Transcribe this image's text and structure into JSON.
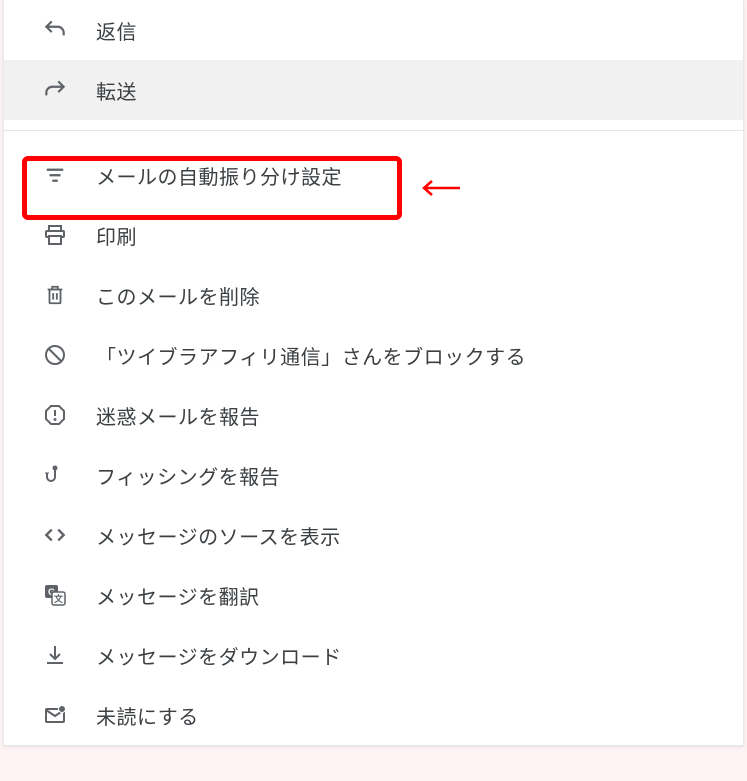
{
  "menu": {
    "items": [
      {
        "id": "reply",
        "label": "返信",
        "icon": "reply-icon"
      },
      {
        "id": "forward",
        "label": "転送",
        "icon": "forward-icon"
      },
      {
        "id": "filter",
        "label": "メールの自動振り分け設定",
        "icon": "filter-icon"
      },
      {
        "id": "print",
        "label": "印刷",
        "icon": "print-icon"
      },
      {
        "id": "delete",
        "label": "このメールを削除",
        "icon": "delete-icon"
      },
      {
        "id": "block",
        "label": "「ツイブラアフィリ通信」さんをブロックする",
        "icon": "block-icon"
      },
      {
        "id": "report-spam",
        "label": "迷惑メールを報告",
        "icon": "report-spam-icon"
      },
      {
        "id": "report-phishing",
        "label": "フィッシングを報告",
        "icon": "phishing-icon"
      },
      {
        "id": "show-original",
        "label": "メッセージのソースを表示",
        "icon": "code-icon"
      },
      {
        "id": "translate",
        "label": "メッセージを翻訳",
        "icon": "translate-icon"
      },
      {
        "id": "download",
        "label": "メッセージをダウンロード",
        "icon": "download-icon"
      },
      {
        "id": "mark-unread",
        "label": "未読にする",
        "icon": "mark-unread-icon"
      }
    ]
  },
  "annotation": {
    "highlighted_item": "filter",
    "highlight_color": "#ff0000"
  }
}
